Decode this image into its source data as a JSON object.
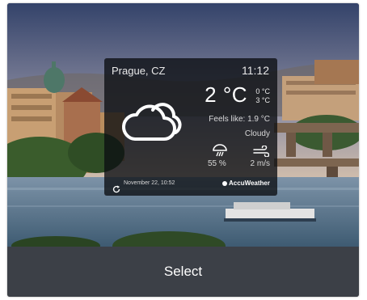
{
  "widget": {
    "city": "Prague, CZ",
    "time": "11:12",
    "temperature": "2 °C",
    "high": "0 °C",
    "low": "3 °C",
    "feels_like": "Feels like: 1.9 °C",
    "condition": "Cloudy",
    "precipitation": "55 %",
    "wind": "2 m/s",
    "updated": "November 22, 10:52",
    "provider": "AccuWeather",
    "condition_icon": "cloud-icon",
    "precipitation_icon": "umbrella-rain-icon",
    "wind_icon": "wind-icon",
    "refresh_icon": "refresh-icon"
  },
  "background": {
    "description_colors": {
      "sky_top": "#3b4a72",
      "sky_bottom": "#c9b7a6",
      "river": "#5d7f9a",
      "bridge": "#8a6e55",
      "foliage": "#355a2d"
    }
  },
  "footer": {
    "select_label": "Select",
    "bar_color": "#3c4047"
  }
}
